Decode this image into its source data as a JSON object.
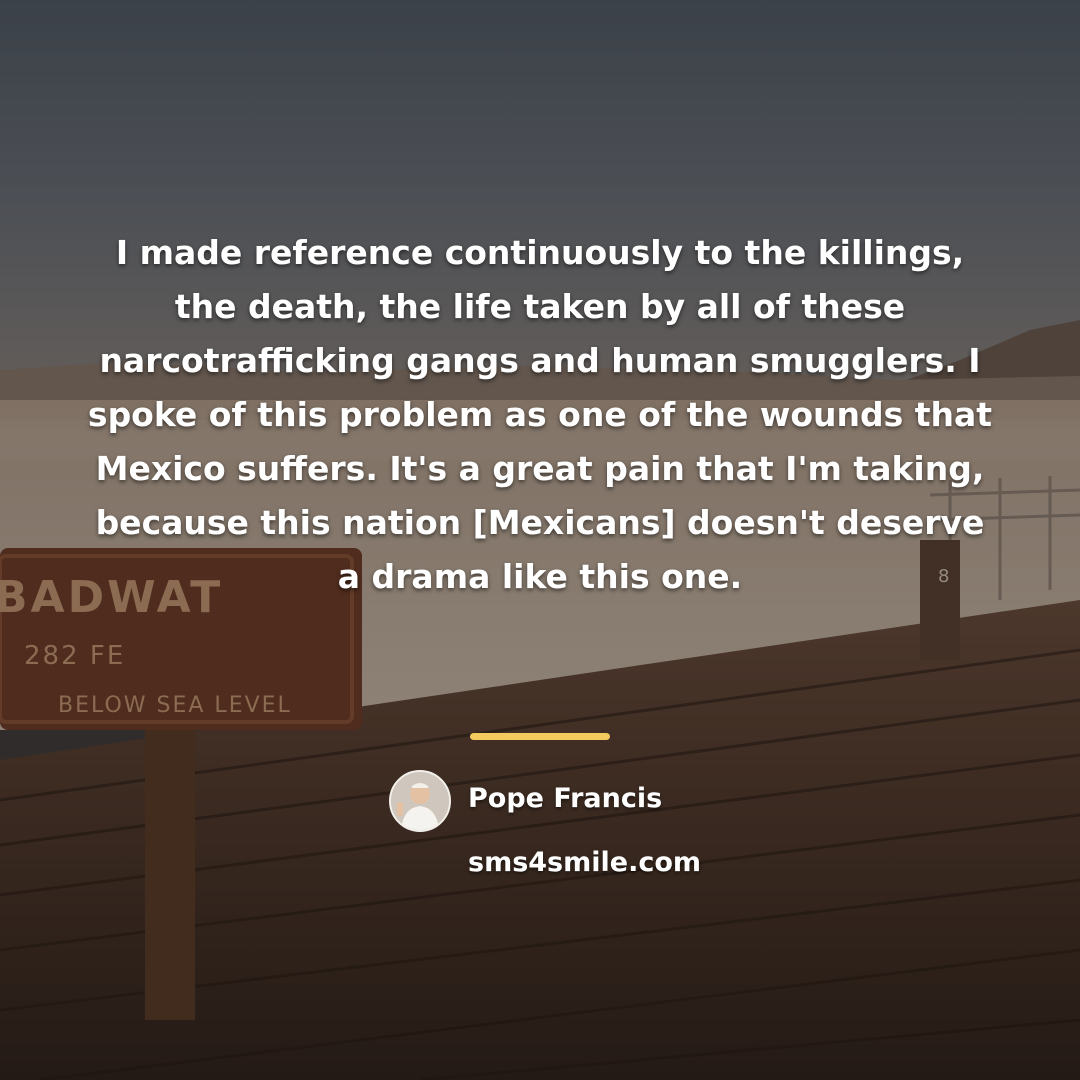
{
  "background": {
    "sign_lines": [
      "BADWAT",
      "282 FE",
      "BELOW SEA LEVEL"
    ],
    "sign_fragment": "8",
    "colors": {
      "sky": "#5c6670",
      "desert": "#c9b8a6",
      "boardwalk": "#4a3426",
      "sign": "#6e3b24"
    }
  },
  "quote": {
    "text": "I made reference continuously to the killings, the death, the life taken by all of these narcotrafficking gangs and human smugglers. I spoke of this problem as one of the wounds that Mexico suffers. It's a great pain that I'm taking, because this nation [Mexicans] doesn't deserve a drama like this one."
  },
  "divider": {
    "color": "#f4c95d"
  },
  "author": {
    "name": "Pope Francis",
    "avatar_icon": "person-portrait-icon"
  },
  "site": {
    "domain": "sms4smile.com"
  }
}
